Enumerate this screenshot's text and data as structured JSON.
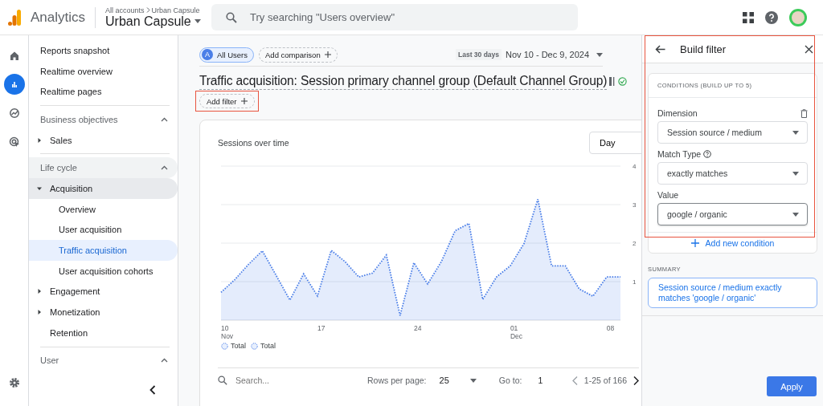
{
  "app": {
    "name": "Analytics",
    "breadcrumb": [
      "All accounts",
      "Urban Capsule"
    ],
    "property": "Urban Capsule"
  },
  "search": {
    "placeholder": "Try searching \"Users overview\""
  },
  "rail": [
    {
      "kind": "home",
      "selected": false
    },
    {
      "kind": "reports",
      "selected": true
    },
    {
      "kind": "explore",
      "selected": false
    },
    {
      "kind": "advertising",
      "selected": false
    }
  ],
  "nav": [
    {
      "kind": "link",
      "label": "Reports snapshot",
      "selected": false
    },
    {
      "kind": "link",
      "label": "Realtime overview",
      "selected": false
    },
    {
      "kind": "link",
      "label": "Realtime pages",
      "selected": false
    },
    {
      "kind": "section",
      "label": "Business objectives",
      "expanded": true,
      "children": [
        {
          "kind": "group",
          "label": "Sales",
          "expanded": false
        }
      ]
    },
    {
      "kind": "section",
      "label": "Life cycle",
      "expanded": true,
      "children": [
        {
          "kind": "group",
          "label": "Acquisition",
          "expanded": true,
          "children": [
            {
              "kind": "link",
              "label": "Overview",
              "selected": false
            },
            {
              "kind": "link",
              "label": "User acquisition",
              "selected": false
            },
            {
              "kind": "link",
              "label": "Traffic acquisition",
              "selected": true
            },
            {
              "kind": "link",
              "label": "User acquisition cohorts",
              "selected": false
            }
          ]
        },
        {
          "kind": "group",
          "label": "Engagement",
          "expanded": false
        },
        {
          "kind": "group",
          "label": "Monetization",
          "expanded": false
        },
        {
          "kind": "plain",
          "label": "Retention"
        }
      ]
    },
    {
      "kind": "section",
      "label": "User",
      "expanded": true
    }
  ],
  "chips": [
    {
      "kind": "segment",
      "avatar": "A",
      "label": "All Users"
    },
    {
      "kind": "add",
      "label": "Add comparison"
    }
  ],
  "date_range": {
    "preset": "Last 30 days",
    "range": "Nov 10 - Dec 9, 2024"
  },
  "report_title": "Traffic acquisition: Session primary channel group (Default Channel Group)",
  "add_filter": {
    "label": "Add filter",
    "highlighted": true
  },
  "card": {
    "title": "Sessions over time",
    "interval": "Day",
    "chart_data": {
      "type": "area",
      "grid": true,
      "categories": [
        "10 Nov",
        null,
        null,
        null,
        null,
        null,
        null,
        "17",
        null,
        null,
        null,
        null,
        null,
        null,
        "24",
        null,
        null,
        null,
        null,
        null,
        null,
        "01 Dec",
        null,
        null,
        null,
        null,
        null,
        null,
        "08",
        null
      ],
      "ylim": [
        0,
        4
      ],
      "yticks": [
        1,
        2,
        3,
        4
      ],
      "series": [
        {
          "name": "Total",
          "color": "#4a7ee8",
          "values": [
            0.72,
            1.05,
            1.45,
            1.8,
            1.16,
            0.52,
            1.2,
            0.63,
            1.81,
            1.52,
            1.12,
            1.22,
            1.69,
            0.12,
            1.49,
            0.94,
            1.52,
            2.32,
            2.51,
            0.54,
            1.12,
            1.41,
            1.99,
            3.14,
            1.41,
            1.41,
            0.81,
            0.62,
            1.12,
            1.12
          ]
        }
      ]
    },
    "extra_legend": [
      {
        "label": "Total"
      }
    ]
  },
  "table_toolbar": {
    "search_placeholder": "Search...",
    "rows_label": "Rows per page:",
    "rows_value": "25",
    "goto_label": "Go to:",
    "goto_value": "1",
    "range": "1-25 of 166"
  },
  "filter_panel": {
    "title": "Build filter",
    "highlighted": true,
    "conditions_heading": "CONDITIONS (BUILD UP TO 5)",
    "fields": [
      {
        "label": "Dimension",
        "value": "Session source / medium",
        "help": false,
        "deletable": true,
        "focused": false
      },
      {
        "label": "Match Type",
        "value": "exactly matches",
        "help": true,
        "deletable": false,
        "focused": false
      },
      {
        "label": "Value",
        "value": "google / organic",
        "help": false,
        "deletable": false,
        "focused": true
      }
    ],
    "add_condition": "Add new condition",
    "summary_heading": "SUMMARY",
    "summary": "Session source / medium exactly matches 'google / organic'",
    "apply": "Apply"
  }
}
